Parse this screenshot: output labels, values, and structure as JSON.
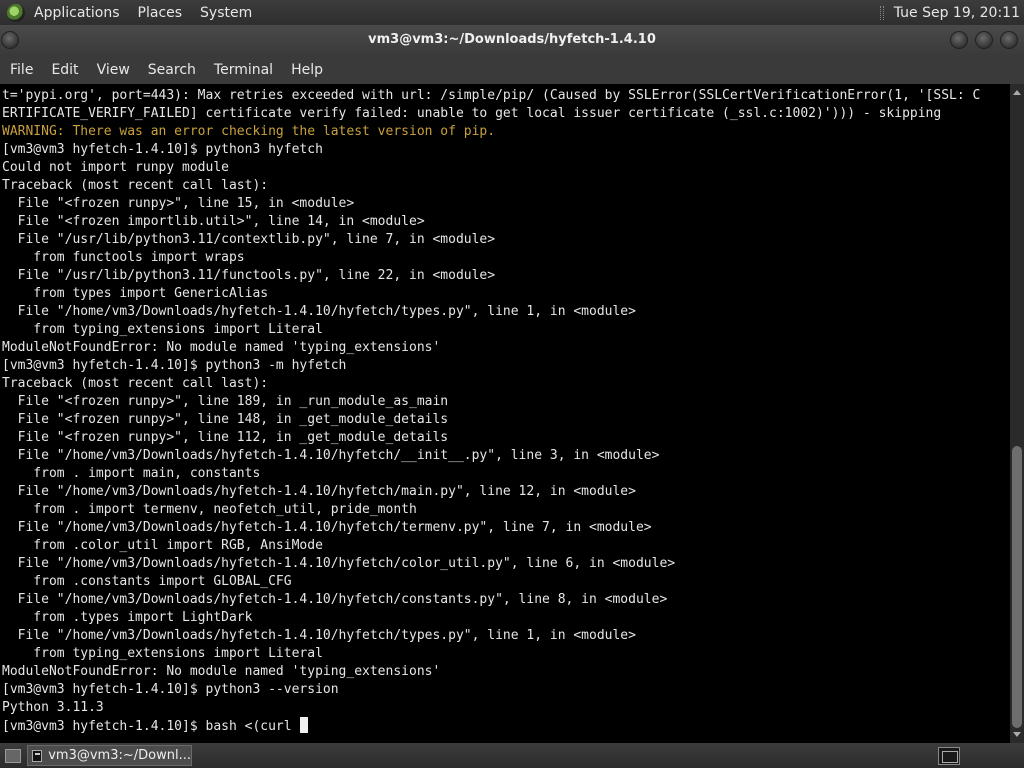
{
  "top_panel": {
    "menus": [
      "Applications",
      "Places",
      "System"
    ],
    "clock": "Tue Sep 19, 20:11"
  },
  "window": {
    "title": "vm3@vm3:~/Downloads/hyfetch-1.4.10"
  },
  "menubar": {
    "items": [
      "File",
      "Edit",
      "View",
      "Search",
      "Terminal",
      "Help"
    ]
  },
  "terminal": {
    "lines": [
      {
        "text": "t='pypi.org', port=443): Max retries exceeded with url: /simple/pip/ (Caused by SSLError(SSLCertVerificationError(1, '[SSL: C",
        "style": "normal"
      },
      {
        "text": "ERTIFICATE_VERIFY_FAILED] certificate verify failed: unable to get local issuer certificate (_ssl.c:1002)'))) - skipping",
        "style": "normal"
      },
      {
        "text": "WARNING: There was an error checking the latest version of pip.",
        "style": "warn"
      },
      {
        "text": "[vm3@vm3 hyfetch-1.4.10]$ python3 hyfetch",
        "style": "normal"
      },
      {
        "text": "Could not import runpy module",
        "style": "normal"
      },
      {
        "text": "Traceback (most recent call last):",
        "style": "normal"
      },
      {
        "text": "  File \"<frozen runpy>\", line 15, in <module>",
        "style": "normal"
      },
      {
        "text": "  File \"<frozen importlib.util>\", line 14, in <module>",
        "style": "normal"
      },
      {
        "text": "  File \"/usr/lib/python3.11/contextlib.py\", line 7, in <module>",
        "style": "normal"
      },
      {
        "text": "    from functools import wraps",
        "style": "normal"
      },
      {
        "text": "  File \"/usr/lib/python3.11/functools.py\", line 22, in <module>",
        "style": "normal"
      },
      {
        "text": "    from types import GenericAlias",
        "style": "normal"
      },
      {
        "text": "  File \"/home/vm3/Downloads/hyfetch-1.4.10/hyfetch/types.py\", line 1, in <module>",
        "style": "normal"
      },
      {
        "text": "    from typing_extensions import Literal",
        "style": "normal"
      },
      {
        "text": "ModuleNotFoundError: No module named 'typing_extensions'",
        "style": "normal"
      },
      {
        "text": "[vm3@vm3 hyfetch-1.4.10]$ python3 -m hyfetch",
        "style": "normal"
      },
      {
        "text": "Traceback (most recent call last):",
        "style": "normal"
      },
      {
        "text": "  File \"<frozen runpy>\", line 189, in _run_module_as_main",
        "style": "normal"
      },
      {
        "text": "  File \"<frozen runpy>\", line 148, in _get_module_details",
        "style": "normal"
      },
      {
        "text": "  File \"<frozen runpy>\", line 112, in _get_module_details",
        "style": "normal"
      },
      {
        "text": "  File \"/home/vm3/Downloads/hyfetch-1.4.10/hyfetch/__init__.py\", line 3, in <module>",
        "style": "normal"
      },
      {
        "text": "    from . import main, constants",
        "style": "normal"
      },
      {
        "text": "  File \"/home/vm3/Downloads/hyfetch-1.4.10/hyfetch/main.py\", line 12, in <module>",
        "style": "normal"
      },
      {
        "text": "    from . import termenv, neofetch_util, pride_month",
        "style": "normal"
      },
      {
        "text": "  File \"/home/vm3/Downloads/hyfetch-1.4.10/hyfetch/termenv.py\", line 7, in <module>",
        "style": "normal"
      },
      {
        "text": "    from .color_util import RGB, AnsiMode",
        "style": "normal"
      },
      {
        "text": "  File \"/home/vm3/Downloads/hyfetch-1.4.10/hyfetch/color_util.py\", line 6, in <module>",
        "style": "normal"
      },
      {
        "text": "    from .constants import GLOBAL_CFG",
        "style": "normal"
      },
      {
        "text": "  File \"/home/vm3/Downloads/hyfetch-1.4.10/hyfetch/constants.py\", line 8, in <module>",
        "style": "normal"
      },
      {
        "text": "    from .types import LightDark",
        "style": "normal"
      },
      {
        "text": "  File \"/home/vm3/Downloads/hyfetch-1.4.10/hyfetch/types.py\", line 1, in <module>",
        "style": "normal"
      },
      {
        "text": "    from typing_extensions import Literal",
        "style": "normal"
      },
      {
        "text": "ModuleNotFoundError: No module named 'typing_extensions'",
        "style": "normal"
      },
      {
        "text": "[vm3@vm3 hyfetch-1.4.10]$ python3 --version",
        "style": "normal"
      },
      {
        "text": "Python 3.11.3",
        "style": "normal"
      },
      {
        "text": "[vm3@vm3 hyfetch-1.4.10]$ bash <(curl ",
        "style": "prompt-active"
      }
    ]
  },
  "taskbar": {
    "task_label": "vm3@vm3:~/Downl..."
  },
  "colors": {
    "terminal_bg": "#000000",
    "terminal_fg": "#e6e6e6",
    "warning": "#c8a03c",
    "panel": "#3a3a3a"
  }
}
